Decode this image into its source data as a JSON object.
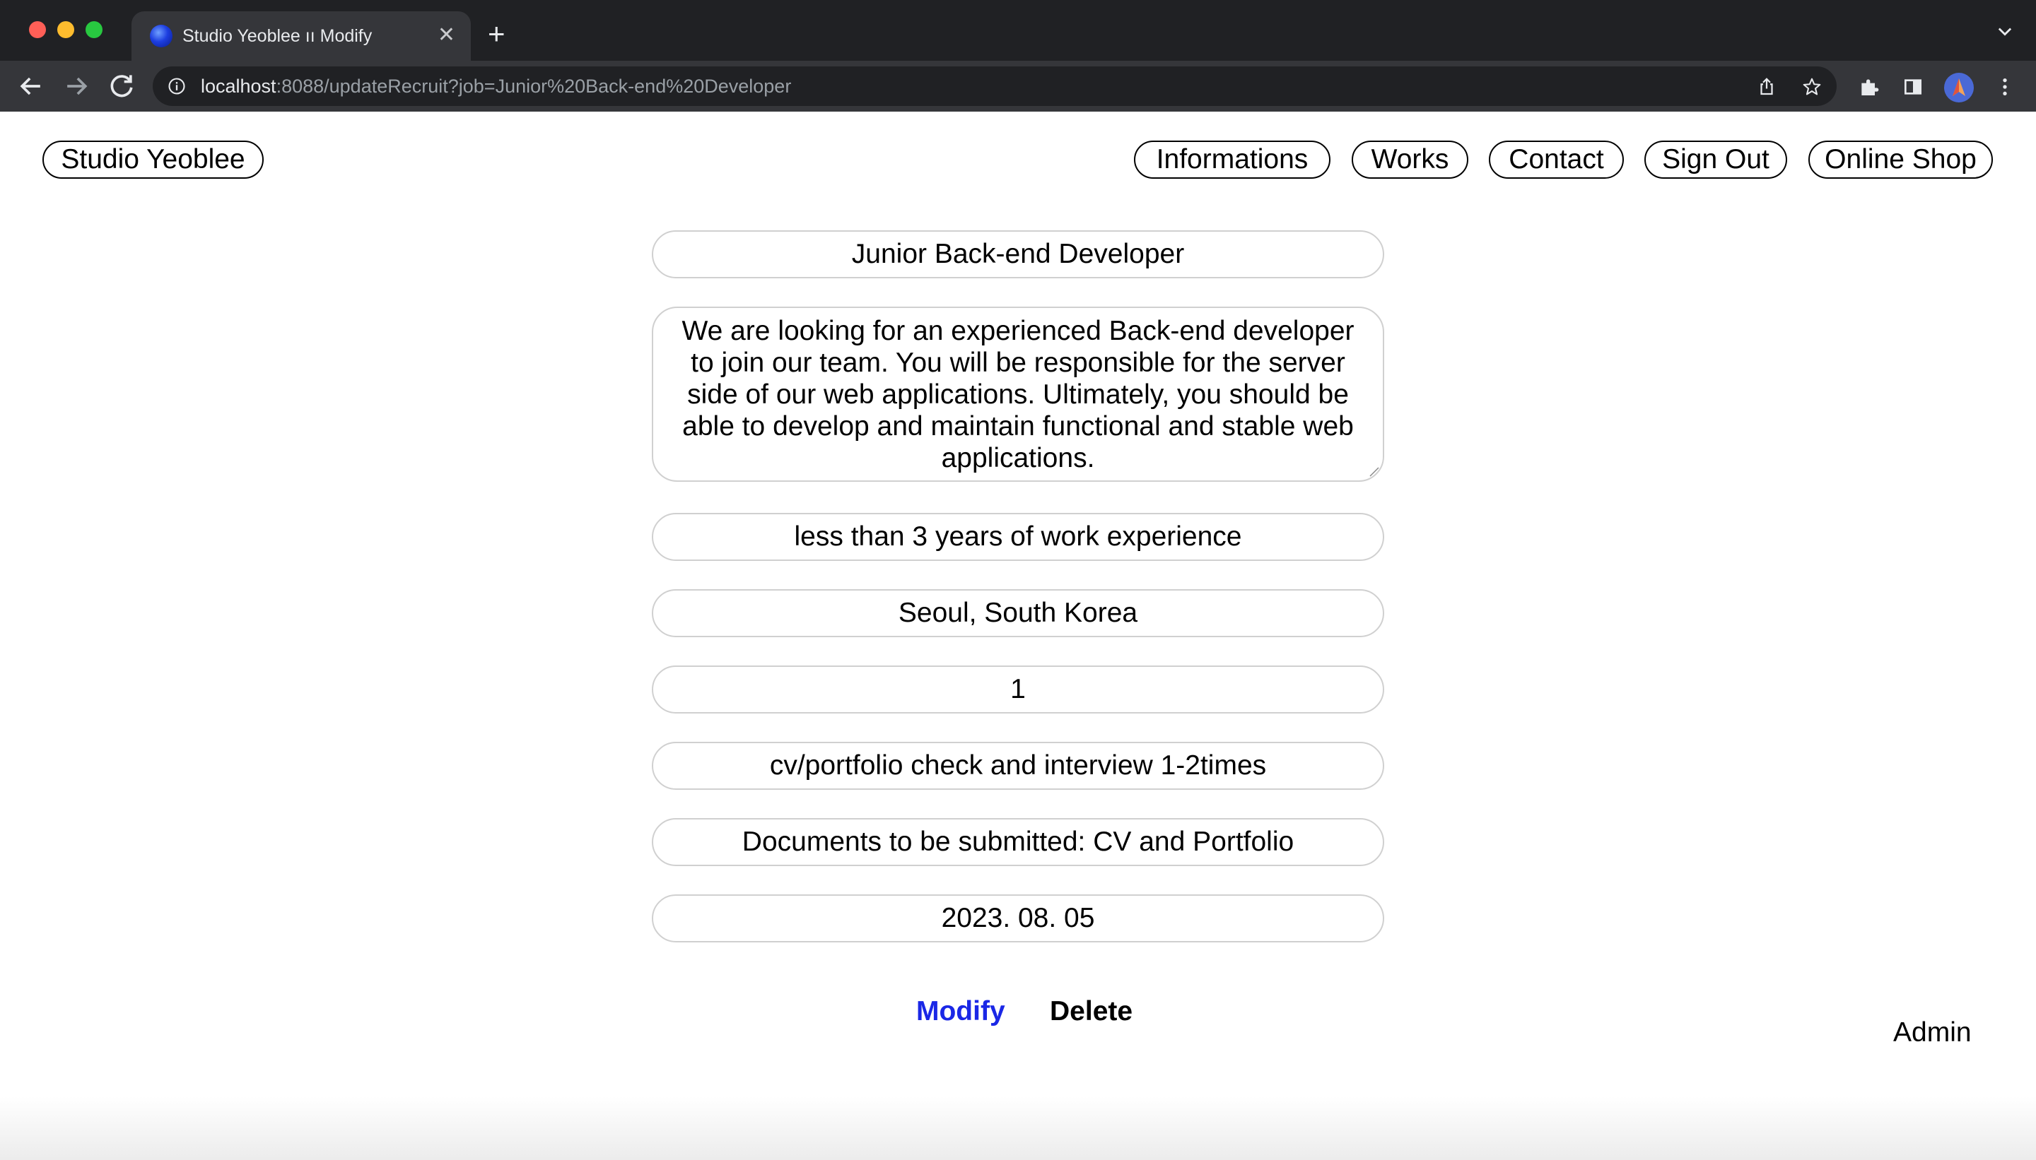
{
  "browser": {
    "tab_title": "Studio Yeoblee ıı Modify",
    "tab_close": "✕",
    "new_tab": "+",
    "url_host": "localhost",
    "url_path": ":8088/updateRecruit?job=Junior%20Back-end%20Developer",
    "favicon": "globe-icon"
  },
  "header": {
    "brand": "Studio Yeoblee",
    "nav": [
      "Informations",
      "Works",
      "Contact",
      "Sign Out",
      "Online Shop"
    ]
  },
  "form": {
    "title": "Junior Back-end Developer",
    "description": "We are looking for an experienced Back-end developer to join our team. You will be responsible for the server side of our web applications. Ultimately, you should be able to develop and maintain functional and stable web applications.",
    "experience": "less than 3 years of work experience",
    "location": "Seoul, South Korea",
    "headcount": "1",
    "process": "cv/portfolio check and interview 1-2times",
    "documents": "Documents to be submitted: CV and Portfolio",
    "deadline": "2023. 08. 05"
  },
  "actions": {
    "modify": "Modify",
    "delete": "Delete"
  },
  "footer": {
    "admin": "Admin"
  },
  "colors": {
    "modify_link": "#1a27e6",
    "field_border": "#d0d0d0",
    "chrome_dark": "#202124",
    "chrome_toolbar": "#35363a"
  }
}
